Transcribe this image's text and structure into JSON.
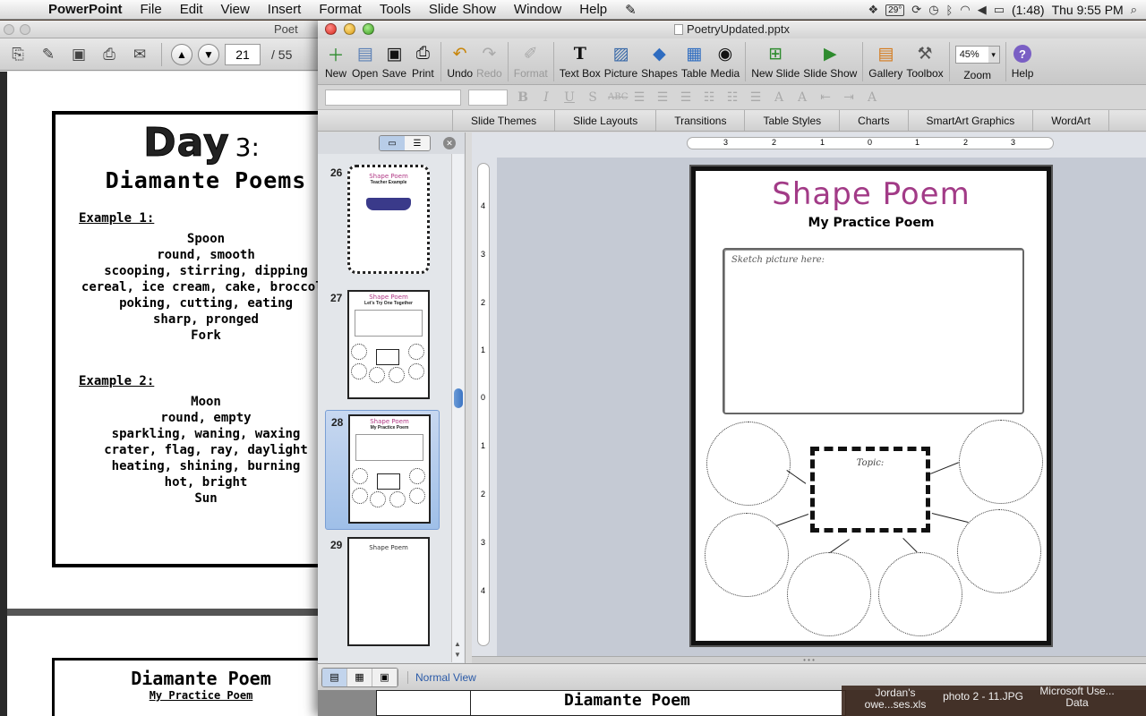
{
  "menubar": {
    "app": "PowerPoint",
    "items": [
      "File",
      "Edit",
      "View",
      "Insert",
      "Format",
      "Tools",
      "Slide Show",
      "Window",
      "Help"
    ],
    "temp": "29°",
    "battery": "(1:48)",
    "clock": "Thu 9:55 PM"
  },
  "pdf": {
    "title": "Poet",
    "page": "21",
    "total": "/ 55",
    "page1": {
      "day": "Day",
      "num": "3:",
      "title": "Diamante Poems",
      "ex1_label": "Example 1:",
      "ex1": [
        "Spoon",
        "round, smooth",
        "scooping, stirring, dipping",
        "cereal, ice cream, cake, broccoli",
        "poking, cutting, eating",
        "sharp, pronged",
        "Fork"
      ],
      "ex2_label": "Example 2:",
      "ex2": [
        "Moon",
        "round, empty",
        "sparkling, waning, waxing",
        "crater, flag, ray, daylight",
        "heating, shining, burning",
        "hot, bright",
        "Sun"
      ]
    },
    "page2": {
      "title": "Diamante Poem",
      "sub": "My Practice Poem"
    }
  },
  "ppt": {
    "doc_title": "PoetryUpdated.pptx",
    "toolbar": {
      "new": "New",
      "open": "Open",
      "save": "Save",
      "print": "Print",
      "undo": "Undo",
      "redo": "Redo",
      "format": "Format",
      "textbox": "Text Box",
      "picture": "Picture",
      "shapes": "Shapes",
      "table": "Table",
      "media": "Media",
      "newslide": "New Slide",
      "slideshow": "Slide Show",
      "gallery": "Gallery",
      "toolbox": "Toolbox",
      "zoom_value": "45%",
      "zoom": "Zoom",
      "help": "Help"
    },
    "ribbon_tabs": [
      "Slide Themes",
      "Slide Layouts",
      "Transitions",
      "Table Styles",
      "Charts",
      "SmartArt Graphics",
      "WordArt"
    ],
    "thumbs": [
      {
        "num": "26",
        "title": "Shape Poem",
        "sub": "Teacher Example"
      },
      {
        "num": "27",
        "title": "Shape Poem",
        "sub": "Let's Try One Together"
      },
      {
        "num": "28",
        "title": "Shape Poem",
        "sub": "My Practice Poem"
      },
      {
        "num": "29",
        "title": "Shape Poem",
        "sub": ""
      }
    ],
    "slide": {
      "title": "Shape Poem",
      "subtitle": "My Practice Poem",
      "sketch_label": "Sketch picture here:",
      "topic_label": "Topic:"
    },
    "ruler_h": [
      "3",
      "2",
      "1",
      "0",
      "1",
      "2",
      "3"
    ],
    "ruler_v": [
      "4",
      "3",
      "2",
      "1",
      "0",
      "1",
      "2",
      "3",
      "4"
    ],
    "status": {
      "view_label": "Normal View"
    },
    "under_title": "Diamante Poem"
  },
  "desktop_files": [
    {
      "name": "Jordan's owe...ses.xls"
    },
    {
      "name": "photo 2 - 11.JPG"
    },
    {
      "name": "Microsoft Use... Data"
    }
  ]
}
